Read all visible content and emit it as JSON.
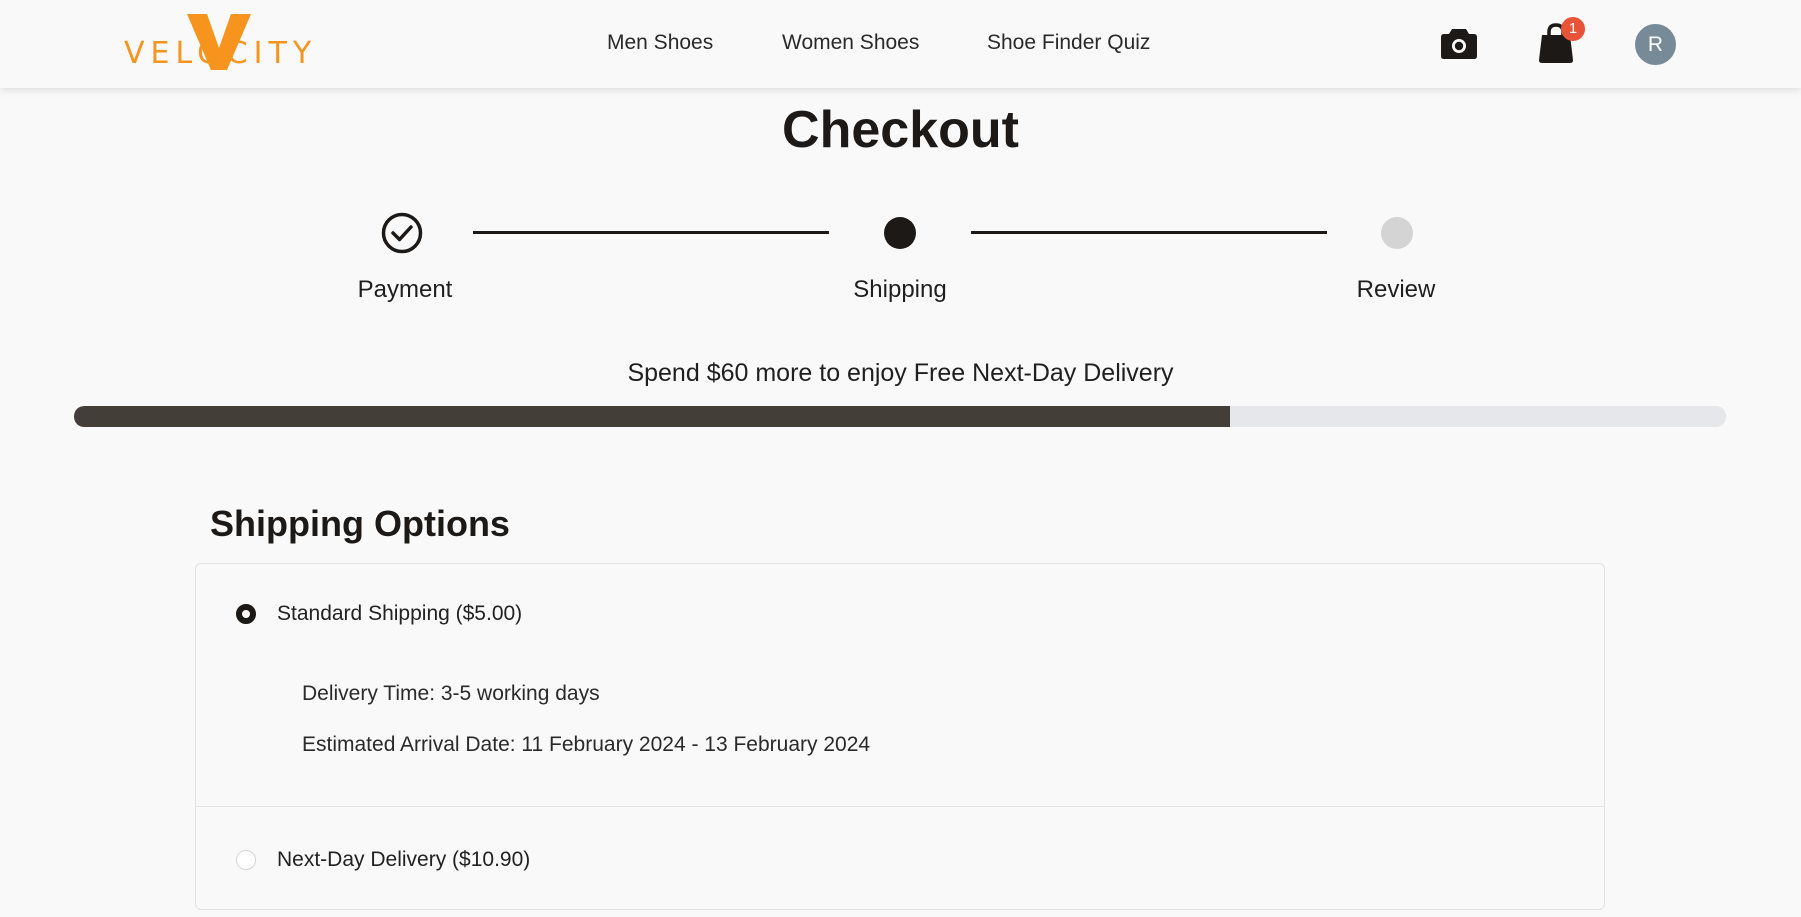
{
  "brand": {
    "logo_text": "VELOCITY",
    "accent_color": "#f7941d"
  },
  "nav": {
    "links": [
      "Men Shoes",
      "Women Shoes",
      "Shoe Finder Quiz"
    ]
  },
  "header_icons": {
    "camera": "camera-icon",
    "cart": "shopping-bag-icon",
    "cart_count": "1",
    "avatar_initial": "R"
  },
  "page": {
    "title": "Checkout"
  },
  "stepper": {
    "steps": [
      {
        "label": "Payment",
        "state": "completed"
      },
      {
        "label": "Shipping",
        "state": "current"
      },
      {
        "label": "Review",
        "state": "upcoming"
      }
    ]
  },
  "promo": {
    "text": "Spend $60 more to enjoy Free Next-Day Delivery",
    "progress_percent": 70
  },
  "shipping": {
    "title": "Shipping Options",
    "options": [
      {
        "label": "Standard Shipping ($5.00)",
        "selected": true,
        "delivery_time": "Delivery Time: 3-5 working days",
        "arrival": "Estimated Arrival Date: 11 February 2024 - 13 February 2024"
      },
      {
        "label": "Next-Day Delivery ($10.90)",
        "selected": false
      }
    ]
  },
  "colors": {
    "dark": "#1c1917",
    "progress_fill": "#433e38",
    "progress_track": "#e5e7eb",
    "badge": "#e8543a",
    "avatar_bg": "#778a98"
  }
}
